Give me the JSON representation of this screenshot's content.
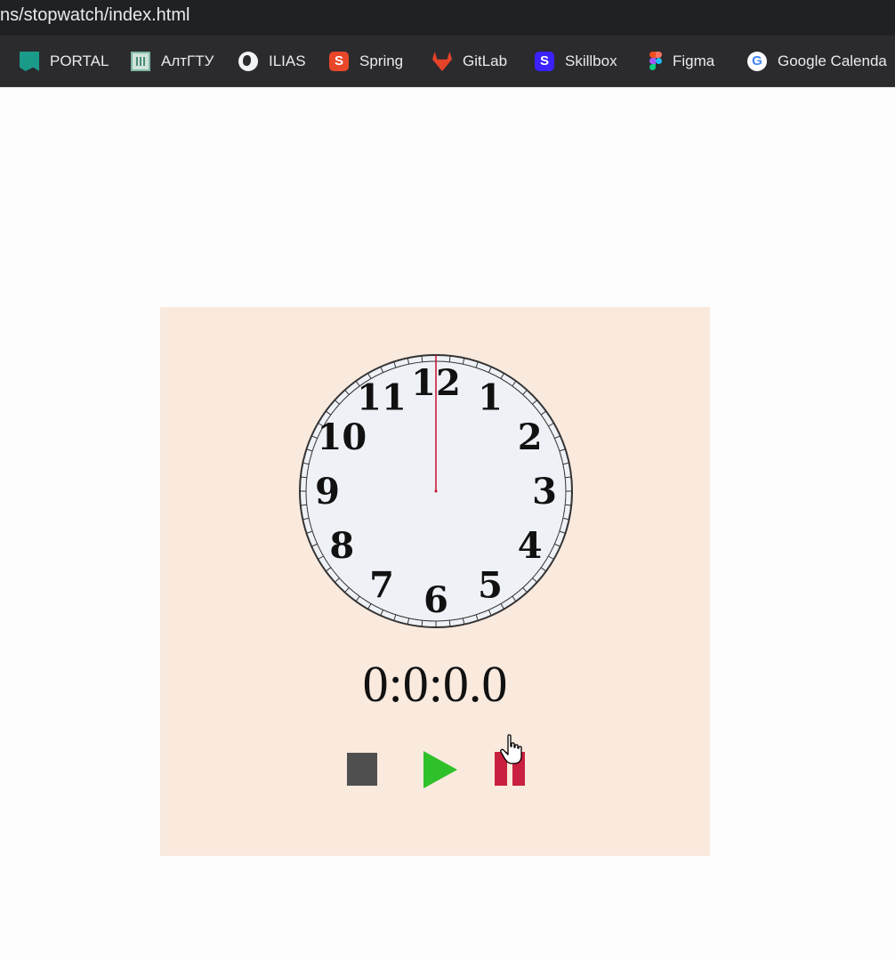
{
  "browser": {
    "url": "ns/stopwatch/index.html",
    "bookmarks": [
      {
        "label": "PORTAL",
        "icon": "portal-icon"
      },
      {
        "label": "АлтГТУ",
        "icon": "altgtu-icon"
      },
      {
        "label": "ILIAS",
        "icon": "globe-icon"
      },
      {
        "label": "Spring",
        "icon": "spring-icon"
      },
      {
        "label": "GitLab",
        "icon": "gitlab-icon"
      },
      {
        "label": "Skillbox",
        "icon": "skillbox-icon"
      },
      {
        "label": "Figma",
        "icon": "figma-icon"
      },
      {
        "label": "Google Calenda",
        "icon": "google-icon"
      }
    ]
  },
  "stopwatch": {
    "clock_numbers": [
      "12",
      "1",
      "2",
      "3",
      "4",
      "5",
      "6",
      "7",
      "8",
      "9",
      "10",
      "11"
    ],
    "second_hand_seconds": 0,
    "display": "0:0:0.0",
    "controls": {
      "stop": "stop-icon",
      "play": "play-icon",
      "pause": "pause-icon"
    },
    "colors": {
      "card_background": "#fae9dd",
      "dial": "#eef1f6",
      "second_hand": "#c8102e",
      "stop": "#4f4f4f",
      "play": "#2fc12a",
      "pause": "#c8203e"
    }
  }
}
